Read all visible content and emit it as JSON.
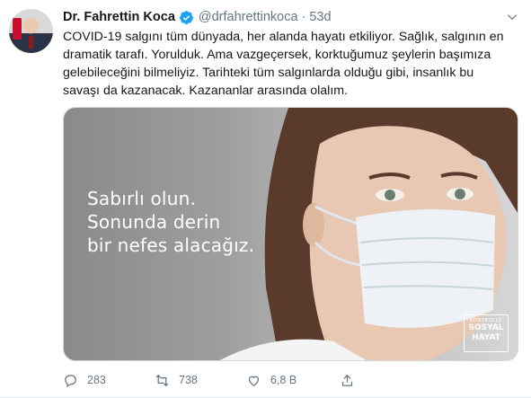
{
  "tweet": {
    "author_name": "Dr. Fahrettin Koca",
    "handle": "@drfahrettinkoca",
    "separator": "·",
    "time": "53d",
    "text_lines": [
      "COVID-19 salgını tüm dünyada, her alanda hayatı etkiliyor. Sağlık, salgının en",
      "dramatik tarafı. Yorulduk. Ama vazgeçersek, korktuğumuz şeylerin başımıza",
      "gelebileceğini bilmeliyiz. Tarihteki tüm salgınlarda olduğu gibi, insanlık bu",
      "savaşı da kazanacak. Kazananlar arasında olalım."
    ],
    "media": {
      "overlay_lines": [
        "Sabırlı olun.",
        "Sonunda derin",
        "bir nefes alacağız."
      ],
      "badge_lines": [
        "KONTROLLÜ",
        "SOSYAL",
        "HAYAT"
      ]
    },
    "actions": {
      "reply_count": "283",
      "retweet_count": "738",
      "like_count": "6,8 B"
    },
    "colors": {
      "verified": "#1da1f2",
      "secondary_text": "#657786",
      "primary_text": "#14171a"
    }
  }
}
